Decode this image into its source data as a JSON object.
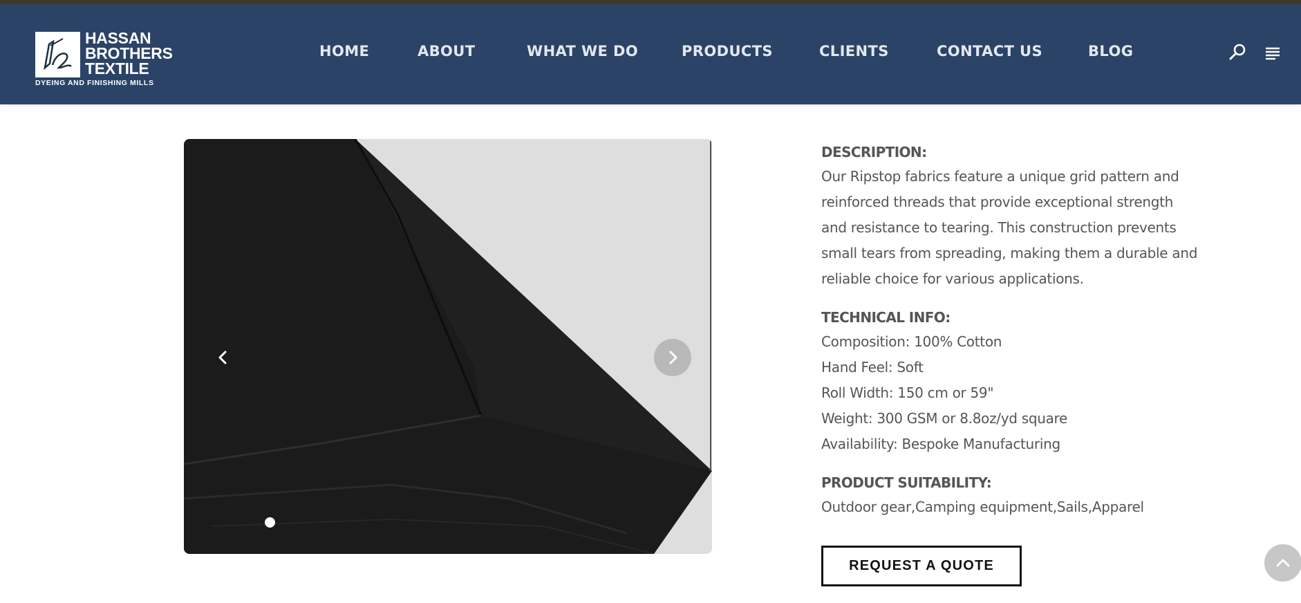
{
  "brand": {
    "name_line1": "HASSAN",
    "name_line2": "BROTHERS",
    "name_line3": "TEXTILE",
    "tagline": "DYEING AND FINISHING MILLS"
  },
  "nav": {
    "items": [
      {
        "label": "HOME"
      },
      {
        "label": "ABOUT"
      },
      {
        "label": "WHAT WE DO"
      },
      {
        "label": "PRODUCTS"
      },
      {
        "label": "CLIENTS"
      },
      {
        "label": "CONTACT US"
      },
      {
        "label": "BLOG"
      }
    ],
    "search_icon": "search-icon",
    "menu_icon": "menu-icon"
  },
  "gallery": {
    "prev_icon": "chevron-left-icon",
    "next_icon": "chevron-right-icon",
    "slide_count": 1,
    "active_slide": 1
  },
  "product": {
    "description_heading": "DESCRIPTION:",
    "description_lines": [
      "Our Ripstop fabrics feature a unique grid pattern and",
      "reinforced threads that provide exceptional strength",
      "and resistance to tearing. This construction prevents",
      "small tears from spreading, making them a durable and",
      "reliable choice for various applications."
    ],
    "technical_heading": "TECHNICAL INFO:",
    "technical_info": [
      "Composition: 100% Cotton",
      "Hand Feel: Soft",
      "Roll Width: 150 cm or 59\"",
      "Weight: 300 GSM or 8.8oz/yd square",
      "Availability: Bespoke Manufacturing"
    ],
    "suitability_heading": "PRODUCT SUITABILITY:",
    "suitability": "Outdoor gear,Camping equipment,Sails,Apparel",
    "quote_button": "REQUEST A QUOTE"
  },
  "colors": {
    "header_bg": "#2b4366",
    "text": "#555555",
    "nav_text": "#e3e8ef"
  }
}
